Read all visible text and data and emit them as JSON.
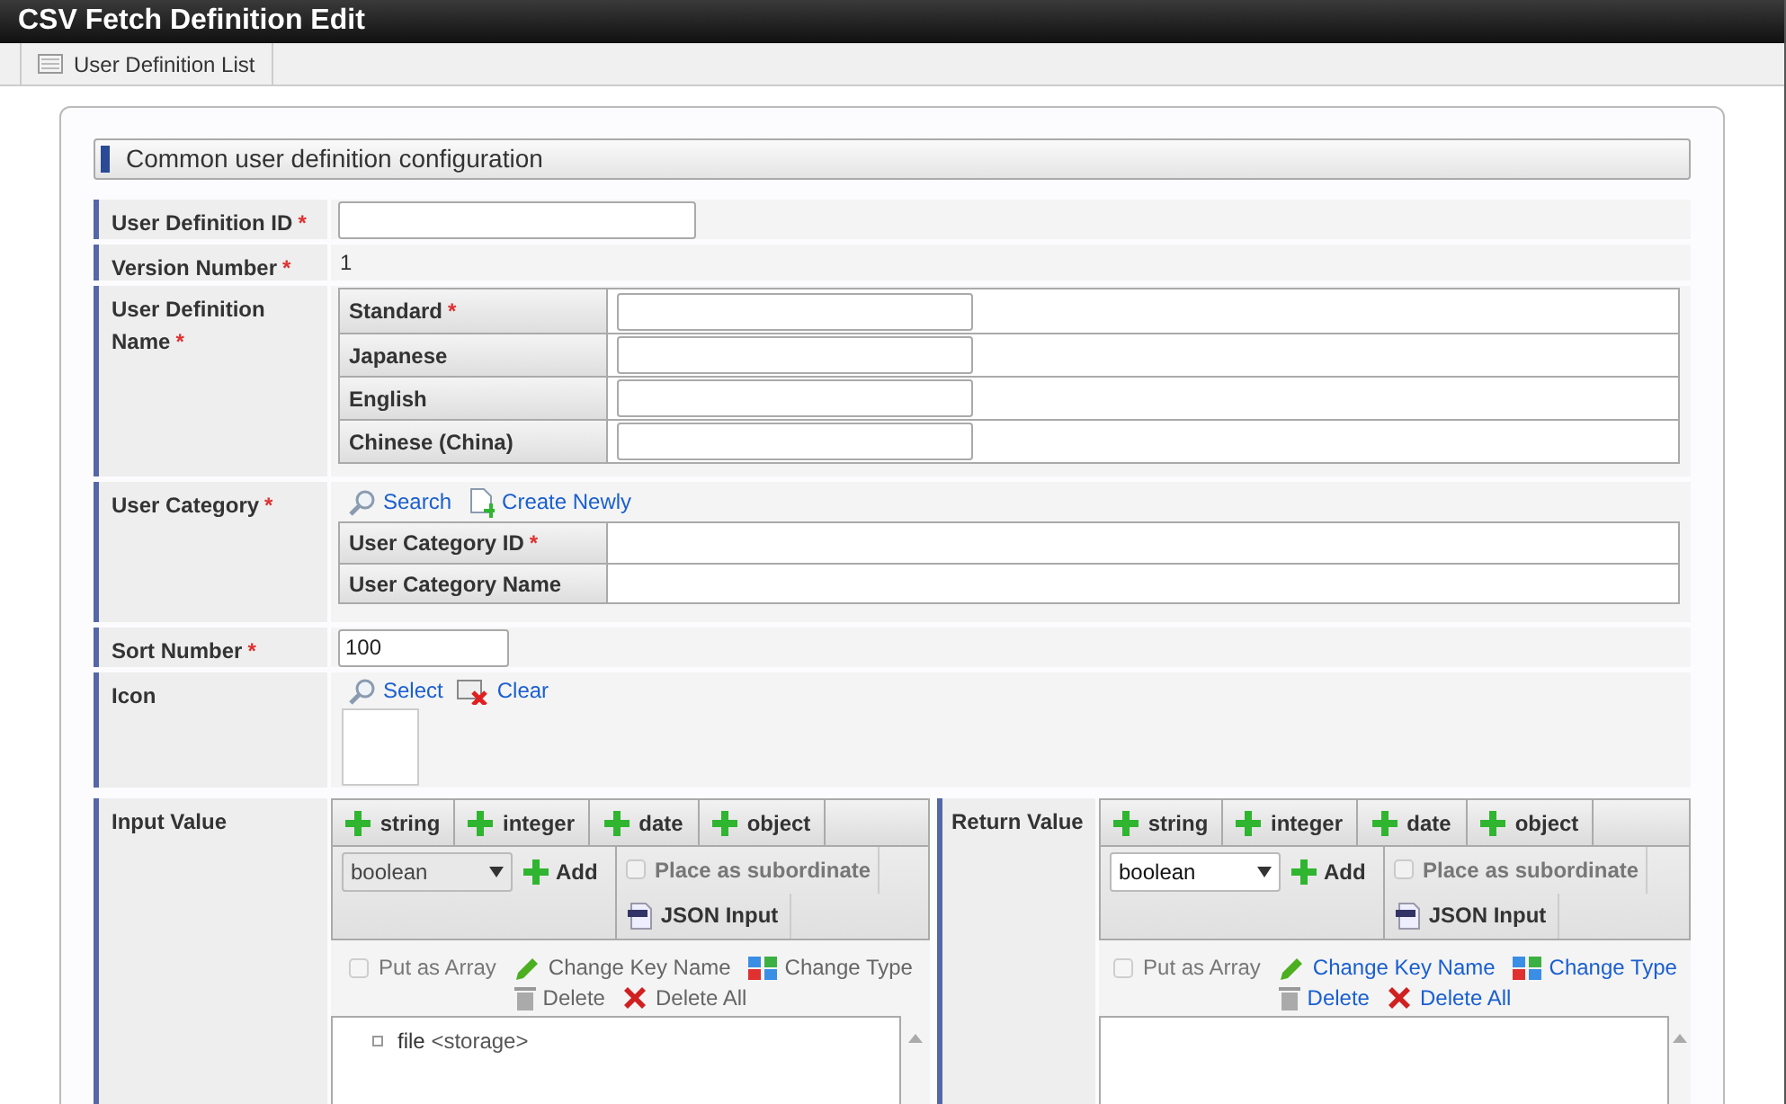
{
  "window": {
    "title": "CSV Fetch Definition Edit"
  },
  "toolbar": {
    "items": [
      {
        "label": "User Definition List"
      }
    ]
  },
  "section": {
    "title": "Common user definition configuration"
  },
  "form": {
    "rows": [
      {
        "kind": "input",
        "label": "User Definition ID",
        "mark": "*"
      },
      {
        "kind": "text",
        "label": "Version Number",
        "mark": "*",
        "value": "1"
      },
      {
        "kind": "localized",
        "label": "User Definition Name",
        "mark": "*",
        "languages": [
          {
            "label": "Standard",
            "mark": "*"
          },
          {
            "label": "Japanese"
          },
          {
            "label": "English"
          },
          {
            "label": "Chinese (China)"
          }
        ]
      },
      {
        "kind": "reference",
        "label": "User Category",
        "mark": "*",
        "links": [
          {
            "label": "Search"
          },
          {
            "label": "Create Newly"
          }
        ],
        "fields": [
          {
            "label": "User Category ID",
            "mark": "*"
          },
          {
            "label": "User Category Name"
          }
        ]
      },
      {
        "kind": "input",
        "label": "Sort Number",
        "mark": "*",
        "value": "100"
      },
      {
        "kind": "icon",
        "label": "Icon",
        "links": [
          {
            "label": "Select"
          },
          {
            "label": "Clear"
          }
        ]
      }
    ]
  },
  "value_panels": [
    {
      "label": "Input Value",
      "disabled": true,
      "type_buttons": [
        "string",
        "integer",
        "date",
        "object"
      ],
      "select": {
        "value": "boolean"
      },
      "add_button": "Add",
      "subordinate": {
        "label": "Place as subordinate",
        "checked": false
      },
      "json_button": "JSON Input",
      "array_option": {
        "label": "Put as Array",
        "checked": false
      },
      "actions": [
        {
          "label": "Change Key Name"
        },
        {
          "label": "Change Type"
        },
        {
          "label": "Delete"
        },
        {
          "label": "Delete All"
        }
      ],
      "tree": [
        {
          "label": "file",
          "type": "<storage>"
        }
      ]
    },
    {
      "label": "Return Value",
      "disabled": false,
      "type_buttons": [
        "string",
        "integer",
        "date",
        "object"
      ],
      "select": {
        "value": "boolean"
      },
      "add_button": "Add",
      "subordinate": {
        "label": "Place as subordinate",
        "checked": false
      },
      "json_button": "JSON Input",
      "array_option": {
        "label": "Put as Array",
        "checked": false
      },
      "actions": [
        {
          "label": "Change Key Name"
        },
        {
          "label": "Change Type"
        },
        {
          "label": "Delete"
        },
        {
          "label": "Delete All"
        }
      ]
    }
  ]
}
